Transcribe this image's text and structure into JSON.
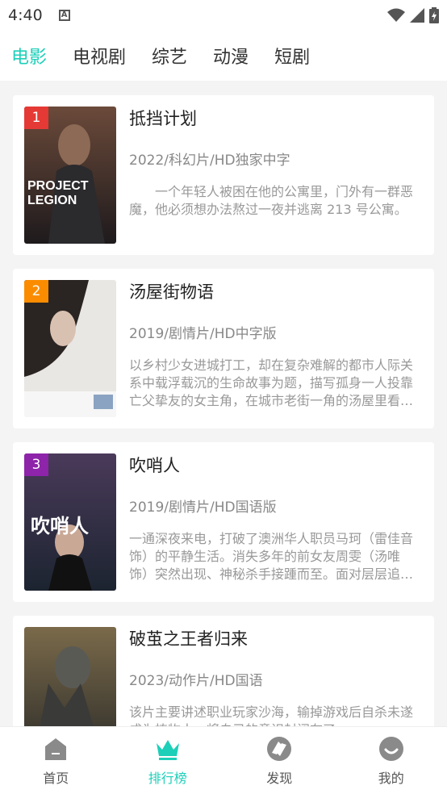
{
  "status": {
    "time": "4:40"
  },
  "tabs": [
    {
      "label": "电影",
      "active": true
    },
    {
      "label": "电视剧",
      "active": false
    },
    {
      "label": "综艺",
      "active": false
    },
    {
      "label": "动漫",
      "active": false
    },
    {
      "label": "短剧",
      "active": false
    }
  ],
  "movies": [
    {
      "rank": "1",
      "rank_color": "#e53935",
      "title": "抵挡计划",
      "meta": "2022/科幻片/HD独家中字",
      "desc": "　　一个年轻人被困在他的公寓里，门外有一群恶魔，他必须想办法熬过一夜并逃离 213 号公寓。",
      "poster_text": "PROJECT LEGION"
    },
    {
      "rank": "2",
      "rank_color": "#fb8c00",
      "title": "汤屋街物语",
      "meta": "2019/剧情片/HD中字版",
      "desc": "以乡村少女进城打工，却在复杂难解的都市人际关系中载浮载沉的生命故事为题，描写孤身一人投靠亡父挚友的女主角，在城市老街一角的汤屋里看遍悲欢离合的惆怅物语…",
      "poster_text": ""
    },
    {
      "rank": "3",
      "rank_color": "#8e24aa",
      "title": "吹哨人",
      "meta": "2019/剧情片/HD国语版",
      "desc": "一通深夜来电，打破了澳洲华人职员马珂（雷佳音 饰）的平静生活。消失多年的前女友周雯（汤唯 饰）突然出现、神秘杀手接踵而至。面对层层追杀，马珂带周雯奔…",
      "poster_text": "吹哨人"
    },
    {
      "rank": "",
      "rank_color": "",
      "title": "破茧之王者归来",
      "meta": "2023/动作片/HD国语",
      "desc": "该片主要讲述职业玩家沙海，输掉游戏后自杀未遂成为植物人，将自己的意识封闭在了…",
      "poster_text": ""
    }
  ],
  "bottom_nav": [
    {
      "label": "首页",
      "icon": "home-icon",
      "active": false
    },
    {
      "label": "排行榜",
      "icon": "crown-icon",
      "active": true
    },
    {
      "label": "发现",
      "icon": "discover-icon",
      "active": false
    },
    {
      "label": "我的",
      "icon": "profile-icon",
      "active": false
    }
  ],
  "colors": {
    "accent": "#1ccfb9"
  }
}
